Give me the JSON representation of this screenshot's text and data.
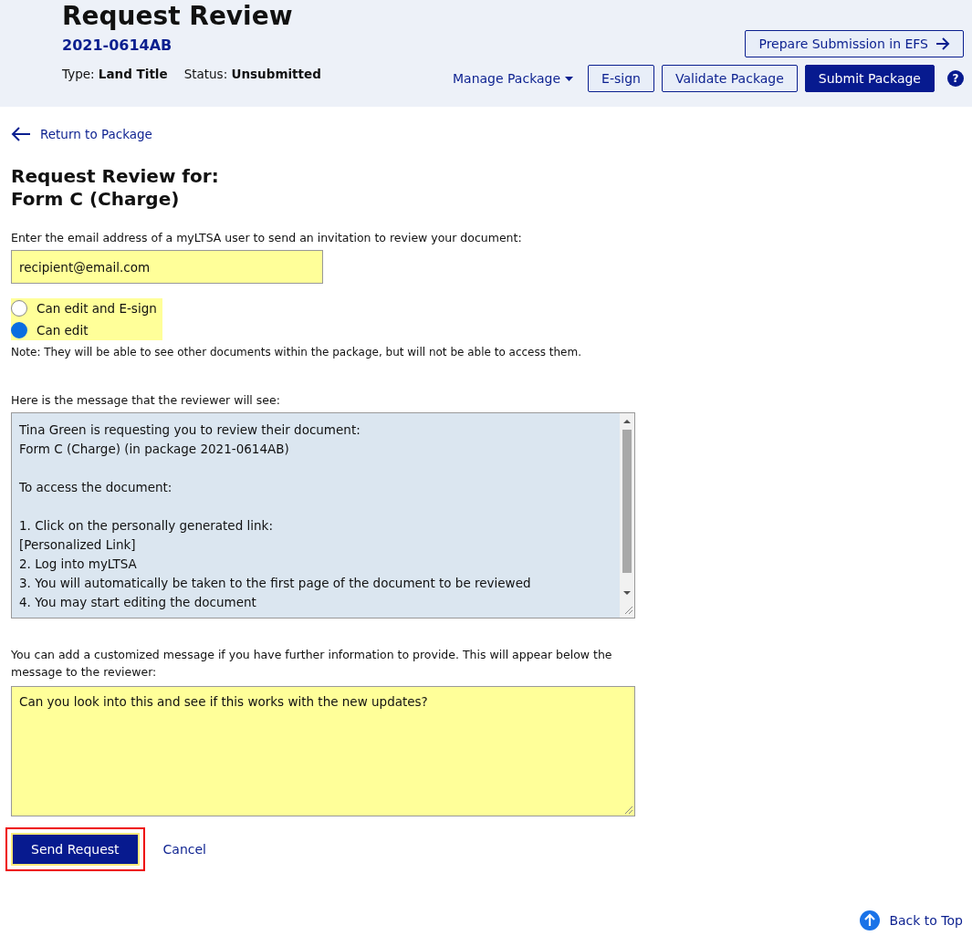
{
  "header": {
    "title": "Request Review",
    "package_number": "2021-0614AB",
    "type_label": "Type:",
    "type_value": "Land Title",
    "status_label": "Status:",
    "status_value": "Unsubmitted",
    "prepare_button": "Prepare Submission in EFS",
    "manage_menu": "Manage Package",
    "buttons": [
      {
        "label": "E-sign",
        "kind": "outline"
      },
      {
        "label": "Validate Package",
        "kind": "outline"
      },
      {
        "label": "Submit Package",
        "kind": "primary"
      }
    ],
    "help": "?"
  },
  "back_link": "Return to Package",
  "heading_lines": [
    "Request Review for:",
    "Form C (Charge)"
  ],
  "email": {
    "label": "Enter the email address of a myLTSA user to send an invitation to review your document:",
    "value": "recipient@email.com"
  },
  "permissions": [
    {
      "label": "Can edit and E-sign",
      "selected": false
    },
    {
      "label": "Can edit",
      "selected": true
    }
  ],
  "note": "Note: They will be able to see other documents within the package, but will not be able to access them.",
  "message": {
    "label": "Here is the message that the reviewer will see:",
    "paragraphs": [
      [
        "Tina Green is requesting you to review their document:",
        "Form C (Charge) (in package 2021-0614AB)"
      ],
      [
        "To access the document:"
      ],
      [
        "1.  Click on the personally generated link:",
        "[Personalized Link]",
        "2.  Log into myLTSA",
        "3.  You will automatically be taken to the first page of the document to be reviewed",
        "4.  You may start editing the document"
      ]
    ]
  },
  "custom_message": {
    "label": "You can add a customized message if you have further information to provide. This will appear below the message to the reviewer:",
    "value": "Can you look into this and see if this works with the new updates?"
  },
  "actions": {
    "send": {
      "label": "Send Request",
      "focused": true
    },
    "cancel": "Cancel"
  },
  "back_to_top": "Back to Top"
}
